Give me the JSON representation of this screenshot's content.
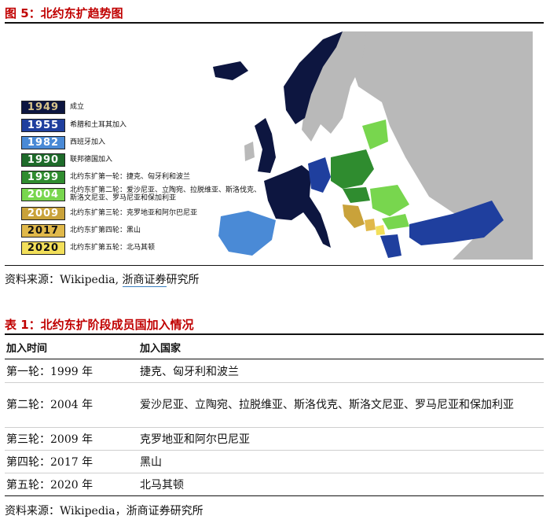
{
  "figure": {
    "caption": "图 5：北约东扩趋势图",
    "source_label": "资料来源：",
    "source_text": "Wikipedia,",
    "source_brand": "浙商证券",
    "source_brand_suffix": "研究所",
    "legend": [
      {
        "year": "1949",
        "text": "成立",
        "color": "#0d1640",
        "text_color": "#d9c58a"
      },
      {
        "year": "1955",
        "text": "希腊和土耳其加入",
        "color": "#1f3f9e",
        "text_color": "#ffffff"
      },
      {
        "year": "1982",
        "text": "西班牙加入",
        "color": "#4a8ad6",
        "text_color": "#ffffff"
      },
      {
        "year": "1990",
        "text": "联邦德国加入",
        "color": "#1e6b2a",
        "text_color": "#ffffff"
      },
      {
        "year": "1999",
        "text": "北约东扩第一轮：捷克、匈牙利和波兰",
        "color": "#2f8c2f",
        "text_color": "#ffffff"
      },
      {
        "year": "2004",
        "text": "北约东扩第二轮：爱沙尼亚、立陶宛、拉脱维亚、斯洛伐克、斯洛文尼亚、罗马尼亚和保加利亚",
        "color": "#78d64e",
        "text_color": "#ffffff"
      },
      {
        "year": "2009",
        "text": "北约东扩第三轮：克罗地亚和阿尔巴尼亚",
        "color": "#c9a23a",
        "text_color": "#ffffff"
      },
      {
        "year": "2017",
        "text": "北约东扩第四轮：黑山",
        "color": "#e0b84a",
        "text_color": "#111111"
      },
      {
        "year": "2020",
        "text": "北约东扩第五轮：北马其顿",
        "color": "#f2df5a",
        "text_color": "#111111"
      }
    ]
  },
  "table": {
    "caption": "表 1：北约东扩阶段成员国加入情况",
    "headers": [
      "加入时间",
      "加入国家"
    ],
    "rows": [
      [
        "第一轮：1999 年",
        "捷克、匈牙利和波兰"
      ],
      [
        "第二轮：2004 年",
        "爱沙尼亚、立陶宛、拉脱维亚、斯洛伐克、斯洛文尼亚、罗马尼亚和保加利亚"
      ],
      [
        "第三轮：2009 年",
        "克罗地亚和阿尔巴尼亚"
      ],
      [
        "第四轮：2017 年",
        "黑山"
      ],
      [
        "第五轮：2020 年",
        "北马其顿"
      ]
    ],
    "source_label": "资料来源：",
    "source_text": "Wikipedia，浙商证券研究所"
  }
}
